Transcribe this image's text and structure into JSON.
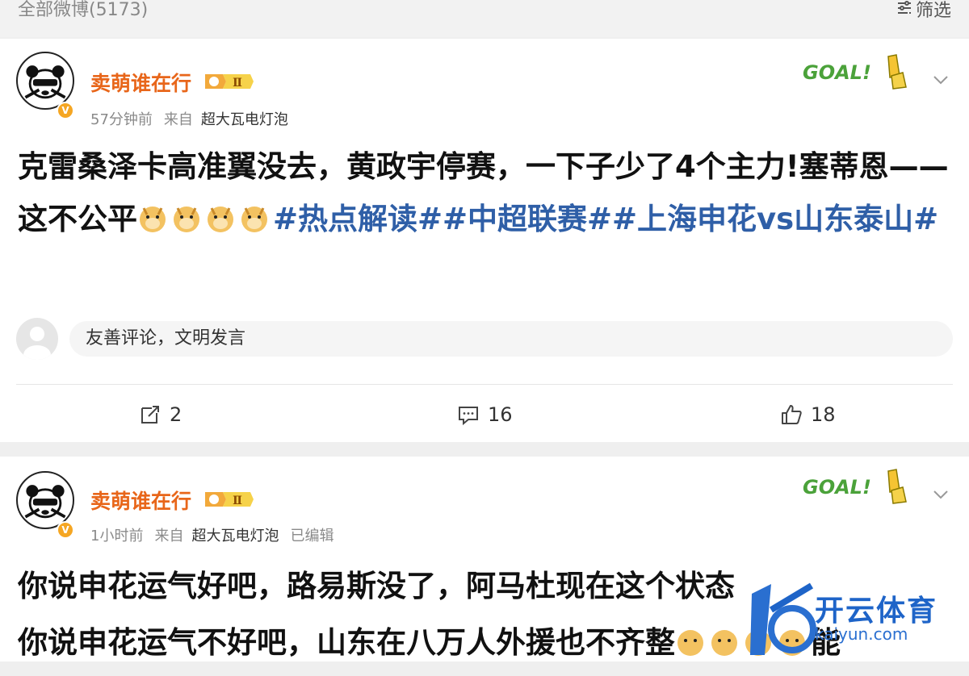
{
  "header": {
    "count_label": "全部微博(5173)",
    "filter_label": "筛选",
    "filter_icon": "filter-icon"
  },
  "posts": [
    {
      "username": "卖萌谁在行",
      "rank_badge": "Ⅱ",
      "time": "57分钟前",
      "source_label": "来自",
      "source": "超大瓦电灯泡",
      "edited": "",
      "goal_badge": "GOAL!",
      "text_plain": "克雷桑泽卡高准翼没去，黄政宇停赛，一下子少了4个主力!塞蒂恩——这不公平",
      "emoji": [
        "doge-emoji",
        "doge-emoji",
        "doge-emoji",
        "doge-emoji"
      ],
      "hashtags": [
        "#热点解读#",
        "#中超联赛#",
        "#上海申花vs山东泰山#"
      ],
      "comment_placeholder": "友善评论，文明发言",
      "repost_count": "2",
      "comment_count": "16",
      "like_count": "18"
    },
    {
      "username": "卖萌谁在行",
      "rank_badge": "Ⅱ",
      "time": "1小时前",
      "source_label": "来自",
      "source": "超大瓦电灯泡",
      "edited": "已编辑",
      "goal_badge": "GOAL!",
      "line1": "你说申花运气好吧，路易斯没了，阿马杜现在这个状态",
      "line2": "你说申花运气不好吧，山东在八万人外援也不齐整",
      "line2_tail": "能"
    }
  ],
  "watermark": {
    "brand": "开云体育",
    "url": "kaiyun.com"
  },
  "colors": {
    "username": "#e8661a",
    "hashtag": "#2f5fa7",
    "meta": "#8a8a8a",
    "watermark": "#1e64c8"
  }
}
